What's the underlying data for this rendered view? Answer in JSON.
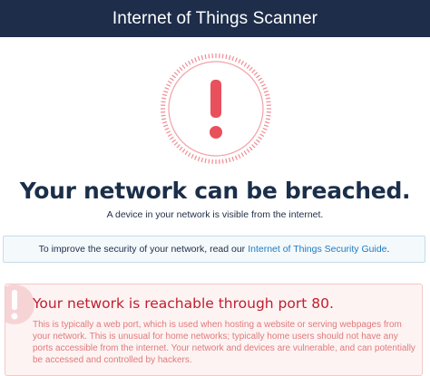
{
  "header": {
    "title": "Internet of Things Scanner"
  },
  "status": {
    "icon": "exclamation-icon",
    "headline": "Your network can be breached.",
    "subline": "A device in your network is visible from the internet."
  },
  "info": {
    "text": "To improve the security of your network, read our",
    "link_label": "Internet of Things Security Guide",
    "suffix": "."
  },
  "warning": {
    "icon": "exclamation-icon",
    "title": "Your network is reachable through port 80.",
    "body": "This is typically a web port, which is used when hosting a website or serving webpages from your network. This is unusual for home networks; typically home users should not have any ports accessible from the internet. Your network and devices are vulnerable, and can potentially be accessed and controlled by hackers."
  },
  "colors": {
    "header_bg": "#1d2d4a",
    "alert_red": "#e8505b",
    "link_blue": "#1f7ac2",
    "warning_text": "#c11e2d"
  }
}
